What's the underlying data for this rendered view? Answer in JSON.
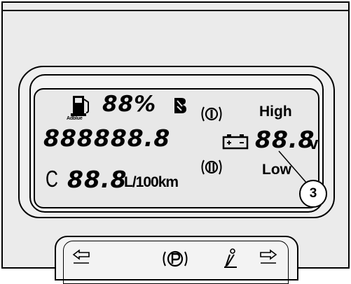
{
  "display": {
    "fuel_percent": "88%",
    "adblue_label": "Adblue",
    "odometer": "888888",
    "odometer_decimal": ".8",
    "voltage_value": "88.8",
    "voltage_unit": "v",
    "consumption_prefix": "C",
    "consumption_value": "88.8",
    "consumption_unit": "L/100km",
    "high_label": "High",
    "low_label": "Low"
  },
  "callout": {
    "number": "3"
  },
  "icons": {
    "fuel": "fuel-pump-icon",
    "rear_fog": "rear-fog-icon",
    "pressure_1": "brake-indicator-1-icon",
    "pressure_2": "brake-indicator-2-icon",
    "battery": "battery-icon",
    "parking": "parking-brake-icon",
    "left_arrow": "left-turn-arrow-icon",
    "right_arrow": "right-turn-arrow-icon",
    "seatbelt": "seatbelt-icon"
  }
}
